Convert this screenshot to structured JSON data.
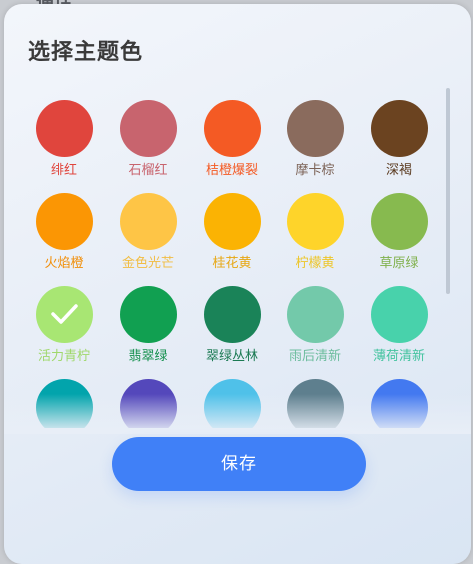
{
  "backdrop": {
    "title": "通话"
  },
  "panel": {
    "title": "选择主题色"
  },
  "colors": [
    {
      "name": "绯红",
      "color": "#e0453d",
      "label_color": "#e0453d",
      "selected": false
    },
    {
      "name": "石榴红",
      "color": "#c8646e",
      "label_color": "#c8646e",
      "selected": false
    },
    {
      "name": "桔橙爆裂",
      "color": "#f45a24",
      "label_color": "#f45a24",
      "selected": false
    },
    {
      "name": "摩卡棕",
      "color": "#8a6b5d",
      "label_color": "#7b6155",
      "selected": false
    },
    {
      "name": "深褐",
      "color": "#6b4320",
      "label_color": "#5a3a1f",
      "selected": false
    },
    {
      "name": "火焰橙",
      "color": "#fb9604",
      "label_color": "#f18f0a",
      "selected": false
    },
    {
      "name": "金色光芒",
      "color": "#fec546",
      "label_color": "#f1bd44",
      "selected": false
    },
    {
      "name": "桂花黄",
      "color": "#fbb303",
      "label_color": "#e7a712",
      "selected": false
    },
    {
      "name": "柠檬黄",
      "color": "#fed42a",
      "label_color": "#edc62a",
      "selected": false
    },
    {
      "name": "草原绿",
      "color": "#87ba4f",
      "label_color": "#7fb04b",
      "selected": false
    },
    {
      "name": "活力青柠",
      "color": "#a8e673",
      "label_color": "#9fd86b",
      "selected": true
    },
    {
      "name": "翡翠绿",
      "color": "#11a051",
      "label_color": "#13904c",
      "selected": false
    },
    {
      "name": "翠绿丛林",
      "color": "#1a8358",
      "label_color": "#1b7a53",
      "selected": false
    },
    {
      "name": "雨后清新",
      "color": "#73c9aa",
      "label_color": "#6dbd9e",
      "selected": false
    },
    {
      "name": "薄荷清新",
      "color": "#48d2ab",
      "label_color": "#43c39f",
      "selected": false
    },
    {
      "name": "",
      "color": "#02a4ac",
      "label_color": "#02a4ac",
      "selected": false
    },
    {
      "name": "",
      "color": "#5448bb",
      "label_color": "#5448bb",
      "selected": false
    },
    {
      "name": "",
      "color": "#4fc1e9",
      "label_color": "#4fc1e9",
      "selected": false
    },
    {
      "name": "",
      "color": "#5e7f8e",
      "label_color": "#5e7f8e",
      "selected": false
    },
    {
      "name": "",
      "color": "#4379f0",
      "label_color": "#4379f0",
      "selected": false
    }
  ],
  "actions": {
    "save_label": "保存"
  }
}
